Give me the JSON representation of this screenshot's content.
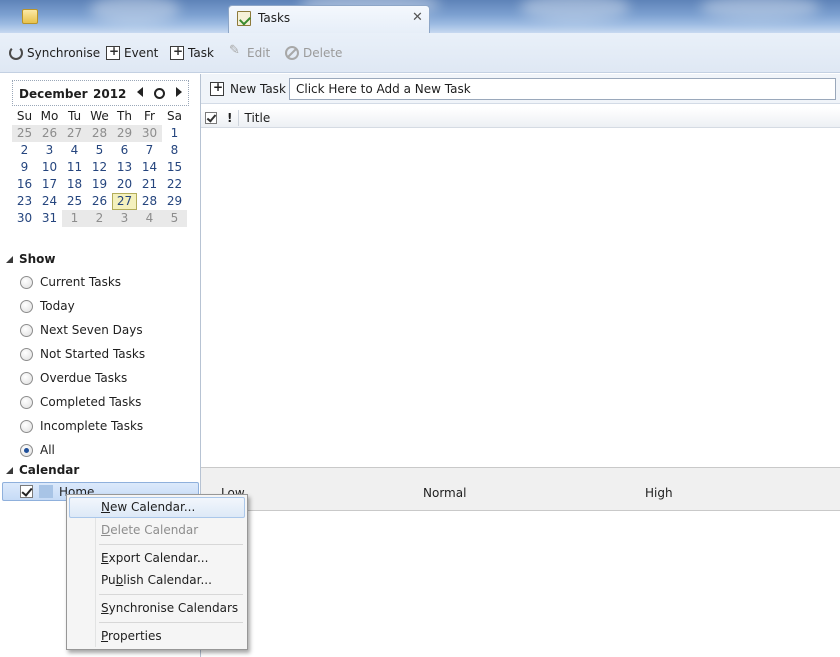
{
  "tabs": {
    "active_label": "Tasks"
  },
  "toolbar": {
    "synchronise": "Synchronise",
    "event": "Event",
    "task": "Task",
    "edit": "Edit",
    "delete": "Delete"
  },
  "minical": {
    "month": "December",
    "year": "2012",
    "dow": [
      "Su",
      "Mo",
      "Tu",
      "We",
      "Th",
      "Fr",
      "Sa"
    ],
    "days": [
      {
        "d": "25",
        "other": true
      },
      {
        "d": "26",
        "other": true
      },
      {
        "d": "27",
        "other": true
      },
      {
        "d": "28",
        "other": true
      },
      {
        "d": "29",
        "other": true
      },
      {
        "d": "30",
        "other": true
      },
      {
        "d": "1"
      },
      {
        "d": "2"
      },
      {
        "d": "3"
      },
      {
        "d": "4"
      },
      {
        "d": "5"
      },
      {
        "d": "6"
      },
      {
        "d": "7"
      },
      {
        "d": "8"
      },
      {
        "d": "9"
      },
      {
        "d": "10"
      },
      {
        "d": "11"
      },
      {
        "d": "12"
      },
      {
        "d": "13"
      },
      {
        "d": "14"
      },
      {
        "d": "15"
      },
      {
        "d": "16"
      },
      {
        "d": "17"
      },
      {
        "d": "18"
      },
      {
        "d": "19"
      },
      {
        "d": "20"
      },
      {
        "d": "21"
      },
      {
        "d": "22"
      },
      {
        "d": "23"
      },
      {
        "d": "24"
      },
      {
        "d": "25"
      },
      {
        "d": "26"
      },
      {
        "d": "27",
        "today": true
      },
      {
        "d": "28"
      },
      {
        "d": "29"
      },
      {
        "d": "30"
      },
      {
        "d": "31"
      },
      {
        "d": "1",
        "other": true
      },
      {
        "d": "2",
        "other": true
      },
      {
        "d": "3",
        "other": true
      },
      {
        "d": "4",
        "other": true
      },
      {
        "d": "5",
        "other": true
      }
    ]
  },
  "show": {
    "title": "Show",
    "filters": [
      {
        "label": "Current Tasks",
        "checked": false
      },
      {
        "label": "Today",
        "checked": false
      },
      {
        "label": "Next Seven Days",
        "checked": false
      },
      {
        "label": "Not Started Tasks",
        "checked": false
      },
      {
        "label": "Overdue Tasks",
        "checked": false
      },
      {
        "label": "Completed Tasks",
        "checked": false
      },
      {
        "label": "Incomplete Tasks",
        "checked": false
      },
      {
        "label": "All",
        "checked": true
      }
    ]
  },
  "calendar": {
    "title": "Calendar",
    "items": [
      {
        "name": "Home",
        "color": "#a8c4e6",
        "enabled": true
      }
    ]
  },
  "new_task": {
    "label": "New Task",
    "placeholder": "Click Here to Add a New Task"
  },
  "task_list": {
    "columns": [
      "Title"
    ]
  },
  "priority": {
    "low": "Low",
    "normal": "Normal",
    "high": "High"
  },
  "context_menu": {
    "new_calendar": "New Calendar...",
    "delete_calendar": "Delete Calendar",
    "export_calendar": "Export Calendar...",
    "publish_calendar": "Publish Calendar...",
    "synchronise_calendars": "Synchronise Calendars",
    "properties": "Properties"
  }
}
